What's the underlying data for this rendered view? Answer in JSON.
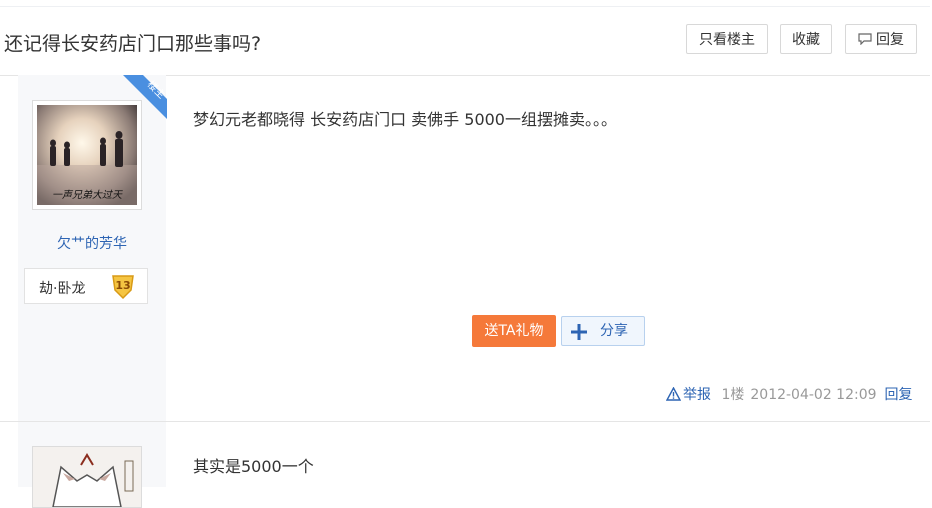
{
  "header": {
    "title": "还记得长安药店门口那些事吗?",
    "only_louzhu": "只看楼主",
    "favorite": "收藏",
    "reply": "回复"
  },
  "posts": [
    {
      "badge": "楼主",
      "avatar_caption": "一声兄弟大过天",
      "username": "欠艹的芳华",
      "level_name": "劫·卧龙",
      "level_num": "13",
      "content": "梦幻元老都晓得 长安药店门口 卖佛手 5000一组摆摊卖。。。",
      "gift_label": "送TA礼物",
      "share_label": "分享",
      "report_label": "举报",
      "floor": "1楼",
      "time": "2012-04-02 12:09",
      "reply_label": "回复"
    },
    {
      "content": "其实是5000一个"
    }
  ],
  "colors": {
    "accent": "#2d64b3",
    "gift": "#f5793a",
    "ribbon": "#4a8fe0",
    "sidebar_bg": "#f7f8fa"
  }
}
